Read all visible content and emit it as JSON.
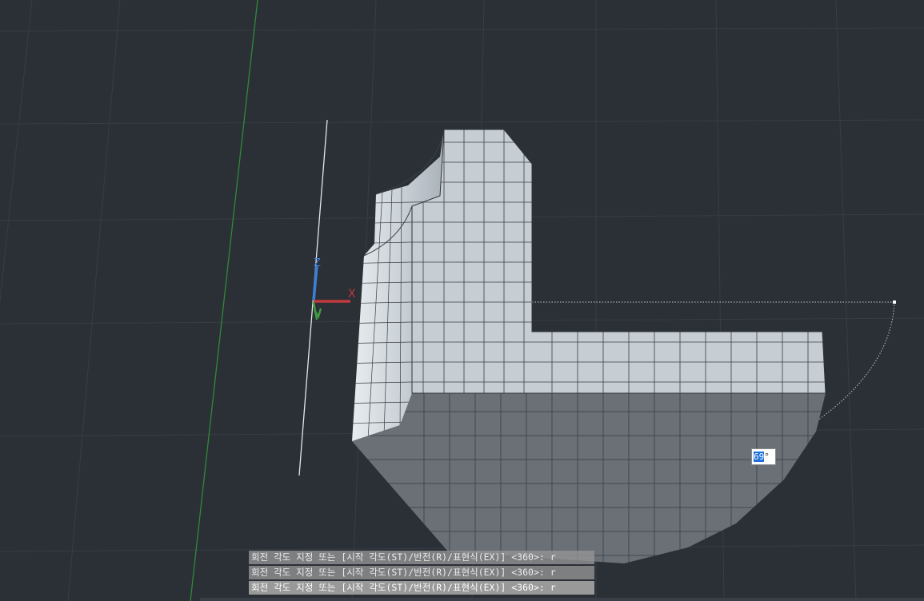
{
  "command_history": [
    "회전 각도 지정 또는 [시작 각도(ST)/반전(R)/표현식(EX)] <360>: r",
    "회전 각도 지정 또는 [시작 각도(ST)/반전(R)/표현식(EX)] <360>: r",
    "회전 각도 지정 또는 [시작 각도(ST)/반전(R)/표현식(EX)] <360>: r"
  ],
  "dynamic_input": {
    "value": "69",
    "unit": "°"
  },
  "ucs": {
    "x_label": "X",
    "z_label": "Z"
  },
  "colors": {
    "background": "#2b2f36",
    "grid": "#383d45",
    "solid_light": "#cfd6dc",
    "solid_dark": "#a9b0b7",
    "ucs_x": "#c0393b",
    "ucs_y": "#3f9b3f",
    "ucs_z": "#3b7fd8"
  }
}
